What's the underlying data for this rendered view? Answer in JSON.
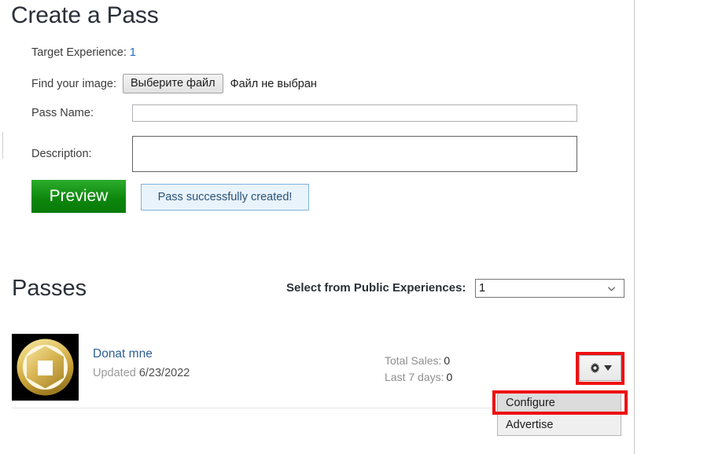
{
  "page": {
    "title": "Create a Pass",
    "passes_heading": "Passes"
  },
  "form": {
    "target_experience_label": "Target Experience:",
    "target_experience_value": "1",
    "find_image_label": "Find your image:",
    "file_button_label": "Выберите файл",
    "file_status": "Файл не выбран",
    "pass_name_label": "Pass Name:",
    "pass_name_value": "",
    "pass_name_placeholder": "",
    "description_label": "Description:",
    "description_value": "",
    "description_placeholder": "",
    "preview_button": "Preview",
    "alert_message": "Pass successfully created!"
  },
  "passes_section": {
    "select_label": "Select from Public Experiences:",
    "selected_experience": "1",
    "experience_options": [
      "1"
    ]
  },
  "pass_item": {
    "name": "Donat mne",
    "updated_label": "Updated",
    "updated_date": "6/23/2022",
    "total_sales_label": "Total Sales:",
    "total_sales_value": "0",
    "last7_label": "Last 7 days:",
    "last7_value": "0",
    "thumbnail_alt": "robux-hexagon-icon"
  },
  "dropdown": {
    "gear_icon": "gear-icon",
    "caret_icon": "caret-down-icon",
    "items": [
      {
        "label": "Configure",
        "highlighted": true
      },
      {
        "label": "Advertise",
        "highlighted": false
      }
    ]
  },
  "colors": {
    "accent_blue": "#2c5f96",
    "link_blue": "#1b6ec2",
    "preview_green": "#0c860c",
    "alert_border": "#7fb2e0",
    "alert_bg": "#e9f3fb",
    "annotation_red": "#ee1111"
  }
}
